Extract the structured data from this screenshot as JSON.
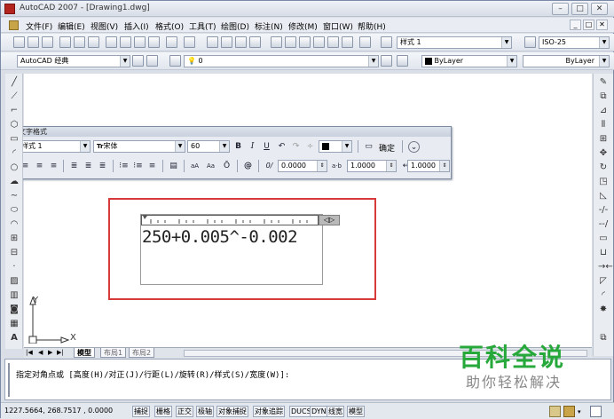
{
  "title": "AutoCAD 2007 - [Drawing1.dwg]",
  "window_buttons": [
    "–",
    "□",
    "✕"
  ],
  "doc_buttons": [
    "_",
    "□",
    "✕"
  ],
  "menu": [
    "文件(F)",
    "编辑(E)",
    "视图(V)",
    "插入(I)",
    "格式(O)",
    "工具(T)",
    "绘图(D)",
    "标注(N)",
    "修改(M)",
    "窗口(W)",
    "帮助(H)"
  ],
  "toolbar1": {
    "text_style": "样式 1",
    "dim_style": "ISO-25"
  },
  "toolbar2": {
    "workspace": "AutoCAD 经典",
    "layer": "0",
    "color": "ByLayer",
    "linetype": "ByLayer"
  },
  "text_formatting": {
    "title": "文字格式",
    "style": "样式 1",
    "font": "宋体",
    "height": "60",
    "bold": "B",
    "italic": "I",
    "underline": "U",
    "ok_label": "确定",
    "oblique": "0.0000",
    "tracking": "1.0000",
    "width": "1.0000"
  },
  "mtext": {
    "content": "250+0.005^-0.002"
  },
  "axis": {
    "y": "Y",
    "x": "X"
  },
  "tabs": [
    "模型",
    "布局1",
    "布局2"
  ],
  "command": {
    "line1": "指定对角点或 [高度(H)/对正(J)/行距(L)/旋转(R)/样式(S)/宽度(W)]:"
  },
  "status": {
    "coords": "1227.5664, 268.7517 , 0.0000",
    "buttons": [
      "捕捉",
      "栅格",
      "正交",
      "极轴",
      "对象捕捉",
      "对象追踪",
      "DUCS",
      "DYN",
      "线宽",
      "模型"
    ]
  },
  "watermark": {
    "title": "百科全说",
    "subtitle": "助你轻松解决"
  },
  "colors": {
    "highlight": "#d73a3a",
    "watermark": "#27a83a"
  }
}
